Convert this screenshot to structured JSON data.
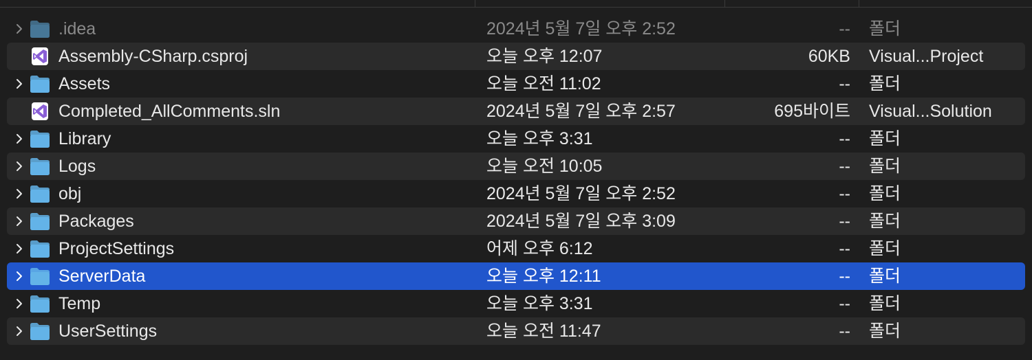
{
  "colors": {
    "background": "#1e1e1e",
    "row_alt": "#2b2b2b",
    "selection": "#2156cc",
    "folder": "#63b3e8",
    "vs_icon": "#8a5fd6"
  },
  "files": [
    {
      "name": ".idea",
      "date": "2024년 5월 7일 오후 2:52",
      "size": "--",
      "kind": "폴더",
      "icon": "folder-icon",
      "expandable": true,
      "dim": true,
      "selected": false
    },
    {
      "name": "Assembly-CSharp.csproj",
      "date": "오늘 오후 12:07",
      "size": "60KB",
      "kind": "Visual...Project",
      "icon": "visual-studio-icon",
      "expandable": false,
      "dim": false,
      "selected": false
    },
    {
      "name": "Assets",
      "date": "오늘 오전 11:02",
      "size": "--",
      "kind": "폴더",
      "icon": "folder-icon",
      "expandable": true,
      "dim": false,
      "selected": false
    },
    {
      "name": "Completed_AllComments.sln",
      "date": "2024년 5월 7일 오후 2:57",
      "size": "695바이트",
      "kind": "Visual...Solution",
      "icon": "visual-studio-icon",
      "expandable": false,
      "dim": false,
      "selected": false
    },
    {
      "name": "Library",
      "date": "오늘 오후 3:31",
      "size": "--",
      "kind": "폴더",
      "icon": "folder-icon",
      "expandable": true,
      "dim": false,
      "selected": false
    },
    {
      "name": "Logs",
      "date": "오늘 오전 10:05",
      "size": "--",
      "kind": "폴더",
      "icon": "folder-icon",
      "expandable": true,
      "dim": false,
      "selected": false
    },
    {
      "name": "obj",
      "date": "2024년 5월 7일 오후 2:52",
      "size": "--",
      "kind": "폴더",
      "icon": "folder-icon",
      "expandable": true,
      "dim": false,
      "selected": false
    },
    {
      "name": "Packages",
      "date": "2024년 5월 7일 오후 3:09",
      "size": "--",
      "kind": "폴더",
      "icon": "folder-icon",
      "expandable": true,
      "dim": false,
      "selected": false
    },
    {
      "name": "ProjectSettings",
      "date": "어제 오후 6:12",
      "size": "--",
      "kind": "폴더",
      "icon": "folder-icon",
      "expandable": true,
      "dim": false,
      "selected": false
    },
    {
      "name": "ServerData",
      "date": "오늘 오후 12:11",
      "size": "--",
      "kind": "폴더",
      "icon": "folder-icon",
      "expandable": true,
      "dim": false,
      "selected": true
    },
    {
      "name": "Temp",
      "date": "오늘 오후 3:31",
      "size": "--",
      "kind": "폴더",
      "icon": "folder-icon",
      "expandable": true,
      "dim": false,
      "selected": false
    },
    {
      "name": "UserSettings",
      "date": "오늘 오전 11:47",
      "size": "--",
      "kind": "폴더",
      "icon": "folder-icon",
      "expandable": true,
      "dim": false,
      "selected": false
    }
  ]
}
